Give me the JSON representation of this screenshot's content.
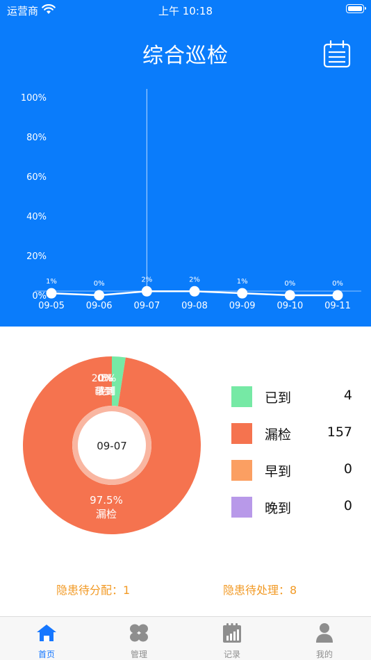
{
  "status_bar": {
    "carrier": "运营商",
    "time": "上午 10:18"
  },
  "header": {
    "title": "综合巡检",
    "calendar_icon": "calendar-icon"
  },
  "chart_data": [
    {
      "type": "line",
      "x": [
        "09-05",
        "09-06",
        "09-07",
        "09-08",
        "09-09",
        "09-10",
        "09-11"
      ],
      "series": [
        {
          "values": [
            1,
            0,
            2,
            2,
            1,
            0,
            0
          ],
          "labels": [
            "1%",
            "0%",
            "2%",
            "2%",
            "1%",
            "0%",
            "0%"
          ]
        }
      ],
      "yticks": [
        "0%",
        "20%",
        "40%",
        "60%",
        "80%",
        "100%"
      ],
      "ylim": [
        0,
        100
      ],
      "selected_x": "09-07",
      "color": "#ffffff"
    },
    {
      "type": "pie",
      "center_label": "09-07",
      "slices": [
        {
          "label": "漏检",
          "value": 157,
          "percent_text": "97.5%",
          "color": "#f5734f"
        },
        {
          "label": "已到",
          "value": 4,
          "percent_text": "2.5%",
          "color": "#76e9a5"
        },
        {
          "label": "早到",
          "value": 0,
          "percent_text": "0%",
          "color": "#fb9f62"
        },
        {
          "label": "晚到",
          "value": 0,
          "percent_text": "0%",
          "color": "#b899e9"
        }
      ]
    }
  ],
  "legend": [
    {
      "label": "已到",
      "value": "4",
      "color": "#76e9a5"
    },
    {
      "label": "漏检",
      "value": "157",
      "color": "#f5734f"
    },
    {
      "label": "早到",
      "value": "0",
      "color": "#fb9f62"
    },
    {
      "label": "晚到",
      "value": "0",
      "color": "#b899e9"
    }
  ],
  "hazards": {
    "pending_assign": "隐患待分配：1",
    "pending_process": "隐患待处理：8"
  },
  "tabs": [
    {
      "label": "首页",
      "icon": "home-icon",
      "active": true
    },
    {
      "label": "管理",
      "icon": "manage-icon",
      "active": false
    },
    {
      "label": "记录",
      "icon": "records-icon",
      "active": false
    },
    {
      "label": "我的",
      "icon": "profile-icon",
      "active": false
    }
  ],
  "colors": {
    "primary": "#0a7cfb",
    "accent": "#f29a25",
    "tab_active": "#1677ff"
  }
}
